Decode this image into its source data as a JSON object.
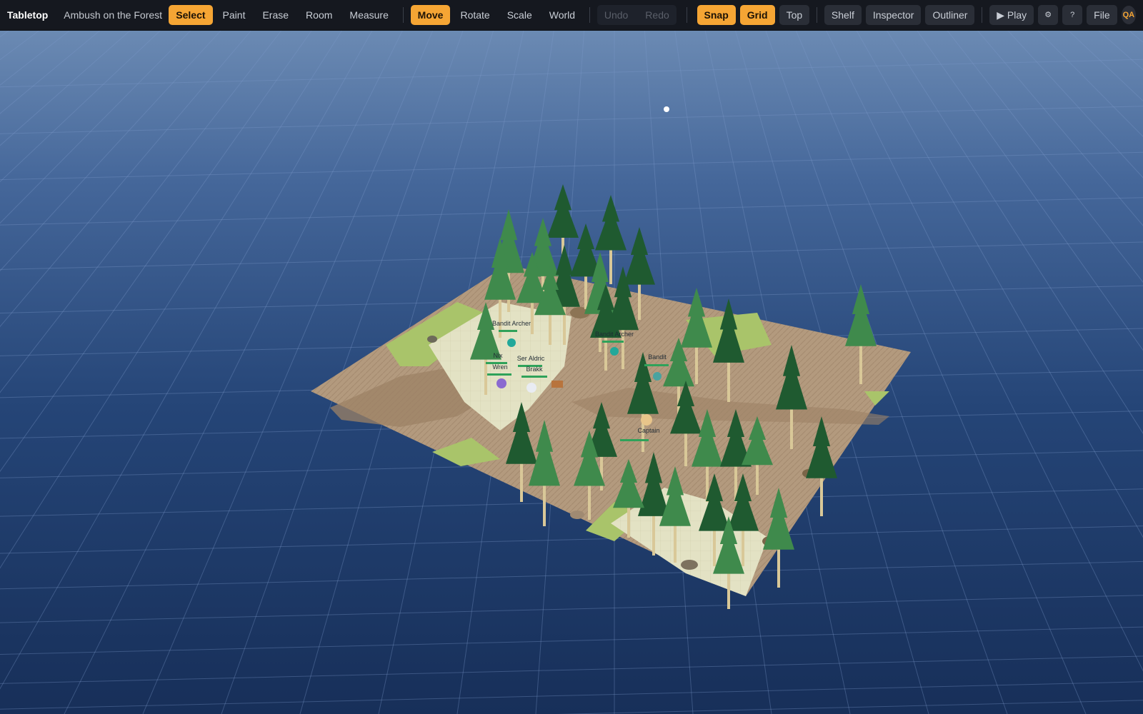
{
  "app": {
    "name": "Tabletop",
    "project_title": "Ambush on the Forest R"
  },
  "toolbar": {
    "tools": [
      {
        "label": "Select",
        "active": true
      },
      {
        "label": "Paint",
        "active": false
      },
      {
        "label": "Erase",
        "active": false
      },
      {
        "label": "Room",
        "active": false
      },
      {
        "label": "Measure",
        "active": false
      }
    ],
    "transform": [
      {
        "label": "Move",
        "active": true
      },
      {
        "label": "Rotate",
        "active": false
      },
      {
        "label": "Scale",
        "active": false
      },
      {
        "label": "World",
        "active": false
      }
    ],
    "history": {
      "undo": "Undo",
      "redo": "Redo",
      "enabled": false
    },
    "view": {
      "snap": "Snap",
      "grid": "Grid",
      "top": "Top"
    },
    "panels": {
      "shelf": "Shelf",
      "inspector": "Inspector",
      "outliner": "Outliner"
    },
    "play_label": "▶ Play",
    "settings_icon": "gear-icon",
    "settings_glyph": "⚙",
    "help_label": "?",
    "file_label": "File",
    "user_initials": "QA"
  },
  "scene": {
    "tokens": [
      {
        "name": "Bandit Archer"
      },
      {
        "name": "Bandit Archer"
      },
      {
        "name": "Bandit"
      },
      {
        "name": "Nix"
      },
      {
        "name": "Wren"
      },
      {
        "name": "Ser Aldric"
      },
      {
        "name": "Brakk"
      },
      {
        "name": "Captain"
      }
    ],
    "colors": {
      "sky_top": "#6b8ab3",
      "sky_bottom": "#1a3360",
      "accent": "#f5a534",
      "grass": "#a9c46a",
      "dirt": "#b39a7e",
      "stone": "#e3e2c4",
      "pine_dark": "#1f5a30",
      "pine_light": "#3f8a4c",
      "health": "#2fa25a"
    }
  }
}
